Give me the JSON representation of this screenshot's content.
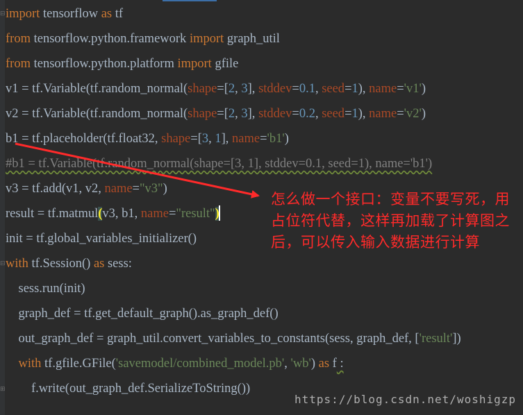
{
  "editor": {
    "lines": [
      [
        {
          "t": "import",
          "c": "kw"
        },
        {
          "t": " tensorflow "
        },
        {
          "t": "as",
          "c": "kw"
        },
        {
          "t": " tf"
        }
      ],
      [
        {
          "t": "from",
          "c": "kw"
        },
        {
          "t": " tensorflow.python.framework "
        },
        {
          "t": "import",
          "c": "kw"
        },
        {
          "t": " graph_util"
        }
      ],
      [
        {
          "t": "from",
          "c": "kw"
        },
        {
          "t": " tensorflow.python.platform "
        },
        {
          "t": "import",
          "c": "kw"
        },
        {
          "t": " gfile"
        }
      ],
      [
        {
          "t": "v1 = tf.Variable(tf.random_normal("
        },
        {
          "t": "shape",
          "c": "param"
        },
        {
          "t": "=["
        },
        {
          "t": "2",
          "c": "num"
        },
        {
          "t": ", "
        },
        {
          "t": "3",
          "c": "num"
        },
        {
          "t": "], "
        },
        {
          "t": "stddev",
          "c": "param"
        },
        {
          "t": "="
        },
        {
          "t": "0.1",
          "c": "num"
        },
        {
          "t": ", "
        },
        {
          "t": "seed",
          "c": "param"
        },
        {
          "t": "="
        },
        {
          "t": "1",
          "c": "num"
        },
        {
          "t": "), "
        },
        {
          "t": "name",
          "c": "param"
        },
        {
          "t": "="
        },
        {
          "t": "'v1'",
          "c": "str"
        },
        {
          "t": ")"
        }
      ],
      [
        {
          "t": "v2 = tf.Variable(tf.random_normal("
        },
        {
          "t": "shape",
          "c": "param"
        },
        {
          "t": "=["
        },
        {
          "t": "2",
          "c": "num"
        },
        {
          "t": ", "
        },
        {
          "t": "3",
          "c": "num"
        },
        {
          "t": "], "
        },
        {
          "t": "stddev",
          "c": "param"
        },
        {
          "t": "="
        },
        {
          "t": "0.2",
          "c": "num"
        },
        {
          "t": ", "
        },
        {
          "t": "seed",
          "c": "param"
        },
        {
          "t": "="
        },
        {
          "t": "1",
          "c": "num"
        },
        {
          "t": "), "
        },
        {
          "t": "name",
          "c": "param"
        },
        {
          "t": "="
        },
        {
          "t": "'v2'",
          "c": "str"
        },
        {
          "t": ")"
        }
      ],
      [
        {
          "t": "b1 = tf.placeholder(tf.float32, "
        },
        {
          "t": "shape",
          "c": "param"
        },
        {
          "t": "=["
        },
        {
          "t": "3",
          "c": "num"
        },
        {
          "t": ", "
        },
        {
          "t": "1",
          "c": "num"
        },
        {
          "t": "], "
        },
        {
          "t": "name",
          "c": "param"
        },
        {
          "t": "="
        },
        {
          "t": "'b1'",
          "c": "str"
        },
        {
          "t": ")"
        }
      ],
      [
        {
          "t": "#b1 = tf.Variable(tf.random_normal(shape=[3, 1], stddev=0.1, seed=1), name='b1')",
          "c": "cmt squig"
        }
      ],
      [
        {
          "t": "v3 = tf.add(v1, v2, "
        },
        {
          "t": "name",
          "c": "param"
        },
        {
          "t": "="
        },
        {
          "t": "\"v3\"",
          "c": "str"
        },
        {
          "t": ")"
        }
      ],
      [
        {
          "t": "result = tf.matmul"
        },
        {
          "t": "(",
          "c": "paren-hl"
        },
        {
          "t": "v3, b1, "
        },
        {
          "t": "name",
          "c": "param"
        },
        {
          "t": "="
        },
        {
          "t": "\"result\"",
          "c": "str"
        },
        {
          "t": ")",
          "c": "paren-hl2"
        },
        {
          "t": "",
          "caret": true
        }
      ],
      [
        {
          "t": "init = tf.global_variables_initializer()"
        }
      ],
      [
        {
          "t": "with",
          "c": "kw"
        },
        {
          "t": " tf.Session() "
        },
        {
          "t": "as",
          "c": "kw"
        },
        {
          "t": " sess:"
        }
      ],
      [
        {
          "t": "    sess.run(init)"
        }
      ],
      [
        {
          "t": "    graph_def = tf.get_default_graph().as_graph_def()"
        }
      ],
      [
        {
          "t": "    out_graph_def = graph_util.convert_variables_to_constants(sess, graph_def, ["
        },
        {
          "t": "'result'",
          "c": "str"
        },
        {
          "t": "])"
        }
      ],
      [
        {
          "t": "    "
        },
        {
          "t": "with",
          "c": "kw"
        },
        {
          "t": " tf.gfile.GFile("
        },
        {
          "t": "'savemodel/combined_model.pb'",
          "c": "str"
        },
        {
          "t": ", "
        },
        {
          "t": "'wb'",
          "c": "str"
        },
        {
          "t": ") "
        },
        {
          "t": "as",
          "c": "kw"
        },
        {
          "t": " f"
        },
        {
          "t": " :",
          "c": "squig"
        }
      ],
      [
        {
          "t": "        f.write(out_graph_def.SerializeToString())"
        }
      ]
    ]
  },
  "annotation": {
    "text": "怎么做一个接口：变量不要写死，用占位符代替，这样再加载了计算图之后，可以传入输入数据进行计算",
    "color": "#ff2a2a"
  },
  "watermark": "https://blog.csdn.net/woshigzp",
  "colors": {
    "background": "#2b2b2b",
    "keyword": "#cc7832",
    "number": "#6897bb",
    "param": "#aa4926",
    "string": "#6a8759",
    "comment": "#808080",
    "default": "#a9b7c6"
  }
}
